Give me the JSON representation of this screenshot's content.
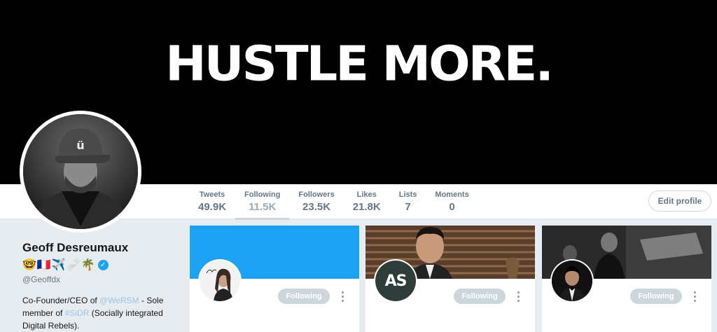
{
  "banner": {
    "text": "HUSTLE MORE."
  },
  "stats": [
    {
      "label": "Tweets",
      "value": "49.9K"
    },
    {
      "label": "Following",
      "value": "11.5K",
      "active": true
    },
    {
      "label": "Followers",
      "value": "23.5K"
    },
    {
      "label": "Likes",
      "value": "21.8K"
    },
    {
      "label": "Lists",
      "value": "7"
    },
    {
      "label": "Moments",
      "value": "0"
    }
  ],
  "edit_profile_label": "Edit profile",
  "profile": {
    "name": "Geoff Desreumaux",
    "emojis": [
      "🤓",
      "🇫🇷",
      "✈️",
      "🩹",
      "🌴"
    ],
    "handle": "@Geoffdx",
    "bio": {
      "part1": "Co-Founder/CEO of ",
      "link1": "@WeRSM",
      "part2": " - Sole member of ",
      "link2": "#SiDR",
      "part3": " (Socially integrated Digital Rebels)."
    }
  },
  "cards": [
    {
      "avatar_text": "",
      "follow_label": "Following"
    },
    {
      "avatar_text": "AS",
      "follow_label": "Following"
    },
    {
      "avatar_text": "",
      "follow_label": "Following"
    }
  ],
  "colors": {
    "accent": "#1da1f2",
    "banner_bg": "#000000",
    "page_bg": "#e6ecf0"
  }
}
